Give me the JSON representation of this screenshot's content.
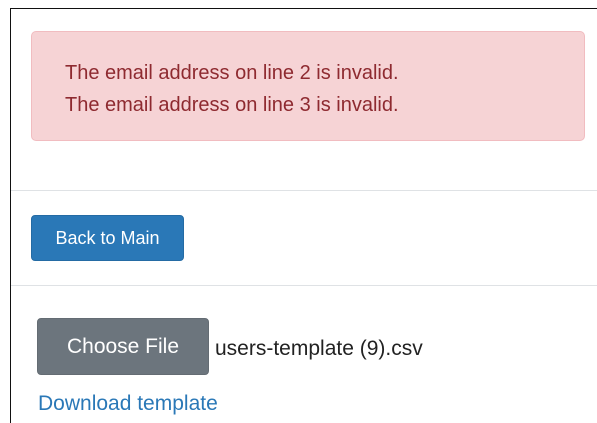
{
  "alert": {
    "messages": [
      "The email address on line 2 is invalid.",
      "The email address on line 3 is invalid."
    ],
    "colors": {
      "background": "#f6d3d5",
      "text": "#8e2a30"
    }
  },
  "actions": {
    "back_label": "Back to Main"
  },
  "upload": {
    "choose_file_label": "Choose File",
    "selected_file": "users-template (9).csv",
    "download_template_label": "Download template"
  },
  "colors": {
    "primary": "#2a78b7",
    "secondary": "#6c757d"
  }
}
